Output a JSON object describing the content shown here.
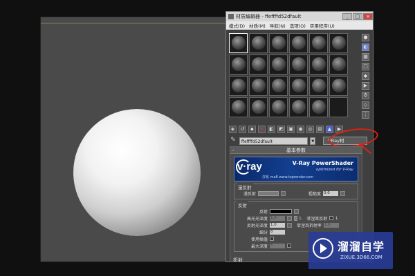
{
  "window": {
    "title": "材质编辑器 - ffeffffd52dfault",
    "minimize": "_",
    "maximize": "□",
    "close": "×"
  },
  "menu": [
    "模式(D)",
    "材质(M)",
    "导航(N)",
    "选项(O)",
    "实用程序(U)"
  ],
  "material": {
    "name": "ffeffffd52dfault",
    "type_button": "VRay材"
  },
  "rollout": {
    "title": "基本参数",
    "collapse": "-",
    "banner": {
      "logo": "v·ray",
      "product": "V-Ray PowerShader",
      "tagline": "optimized for V-Ray",
      "cn": "汉化 ma8 www.toprender.com"
    },
    "diffuse_group": {
      "label": "漫反射",
      "diffuse_label": "漫反射",
      "roughness_label": "粗糙度",
      "roughness_value": "0.0"
    },
    "reflect_group": {
      "label": "反射",
      "reflect_label": "反射",
      "hilight_gloss_label": "高光光泽度",
      "hilight_gloss_value": "1.0",
      "L_label": "L",
      "fresnel_label": "菲涅耳反射",
      "refl_gloss_label": "反射光泽度",
      "refl_gloss_value": "1.0",
      "fresnel_ior_label": "菲涅耳折射率",
      "fresnel_ior_value": "1.6",
      "subdivs_label": "细分",
      "subdivs_value": "8",
      "use_interp_label": "使用插值",
      "max_depth_label": "最大深度",
      "max_depth_value": "5"
    },
    "bottom_group_label": "折射"
  },
  "watermark": {
    "brand": "溜溜自学",
    "url": "ZIXUE.3D66.COM"
  },
  "colors": {
    "viewport_bg": "#4a4a4a",
    "annotation": "#d21",
    "watermark_bg": "#2c3c96"
  }
}
